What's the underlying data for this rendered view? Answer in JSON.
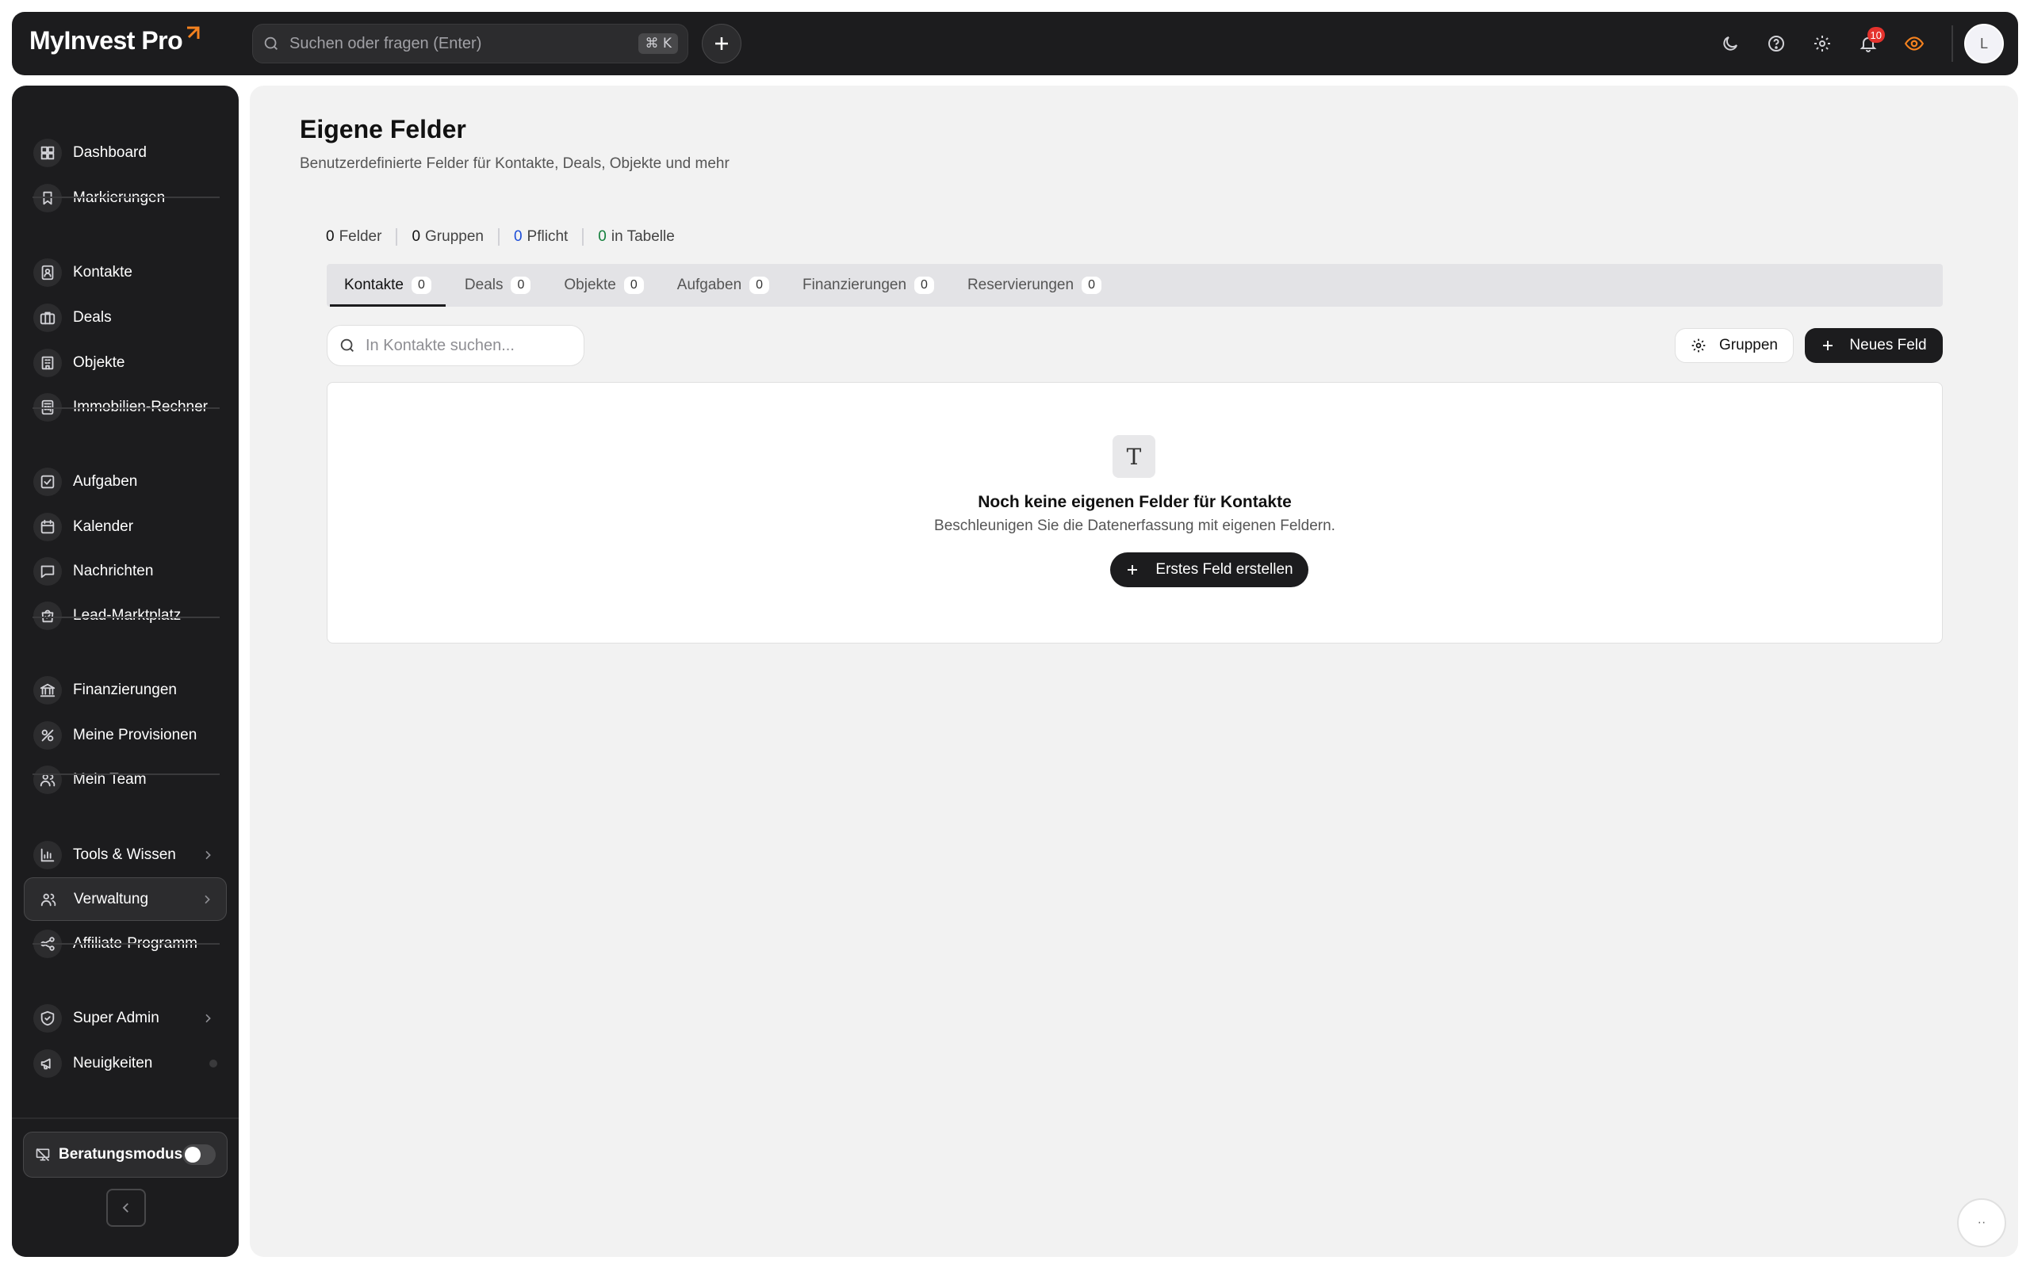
{
  "app": {
    "name": "MyInvest Pro"
  },
  "topbar": {
    "search_placeholder": "Suchen oder fragen (Enter)",
    "shortcut": "⌘ K",
    "notification_count": "10",
    "avatar_initial": "L",
    "accent": "#f5821f"
  },
  "sidebar": {
    "items": [
      {
        "label": "Dashboard",
        "icon": "dashboard-icon"
      },
      {
        "label": "Markierungen",
        "icon": "bookmark-icon"
      },
      {
        "label": "Kontakte",
        "icon": "contacts-icon"
      },
      {
        "label": "Deals",
        "icon": "briefcase-icon"
      },
      {
        "label": "Objekte",
        "icon": "building-icon"
      },
      {
        "label": "Immobilien-Rechner",
        "icon": "calculator-icon"
      },
      {
        "label": "Aufgaben",
        "icon": "task-icon"
      },
      {
        "label": "Kalender",
        "icon": "calendar-icon"
      },
      {
        "label": "Nachrichten",
        "icon": "message-icon"
      },
      {
        "label": "Lead-Marktplatz",
        "icon": "shopping-bag-icon"
      },
      {
        "label": "Finanzierungen",
        "icon": "bank-icon"
      },
      {
        "label": "Meine Provisionen",
        "icon": "commission-icon"
      },
      {
        "label": "Mein Team",
        "icon": "team-icon"
      },
      {
        "label": "Tools & Wissen",
        "icon": "chart-icon"
      },
      {
        "label": "Verwaltung",
        "icon": "admin-users-icon"
      },
      {
        "label": "Affiliate-Programm",
        "icon": "share-icon"
      },
      {
        "label": "Super Admin",
        "icon": "shield-icon"
      },
      {
        "label": "Neuigkeiten",
        "icon": "megaphone-icon"
      }
    ],
    "consult_mode_label": "Beratungsmodus"
  },
  "page": {
    "title": "Eigene Felder",
    "subtitle": "Benutzerdefinierte Felder für Kontakte, Deals, Objekte und mehr"
  },
  "stats": [
    {
      "value": "0",
      "label": "Felder",
      "color": "#111111"
    },
    {
      "value": "0",
      "label": "Gruppen",
      "color": "#111111"
    },
    {
      "value": "0",
      "label": "Pflicht",
      "color": "#1d4ed8"
    },
    {
      "value": "0",
      "label": "in Tabelle",
      "color": "#15803d"
    }
  ],
  "tabs": [
    {
      "label": "Kontakte",
      "count": "0"
    },
    {
      "label": "Deals",
      "count": "0"
    },
    {
      "label": "Objekte",
      "count": "0"
    },
    {
      "label": "Aufgaben",
      "count": "0"
    },
    {
      "label": "Finanzierungen",
      "count": "0"
    },
    {
      "label": "Reservierungen",
      "count": "0"
    }
  ],
  "toolbar": {
    "search_placeholder": "In Kontakte suchen...",
    "groups_label": "Gruppen",
    "new_field_label": "Neues Feld"
  },
  "empty_state": {
    "icon_glyph": "T",
    "title": "Noch keine eigenen Felder für Kontakte",
    "subtitle": "Beschleunigen Sie die Datenerfassung mit eigenen Feldern.",
    "button_label": "Erstes Feld erstellen"
  },
  "fab": {
    "label": "··"
  }
}
